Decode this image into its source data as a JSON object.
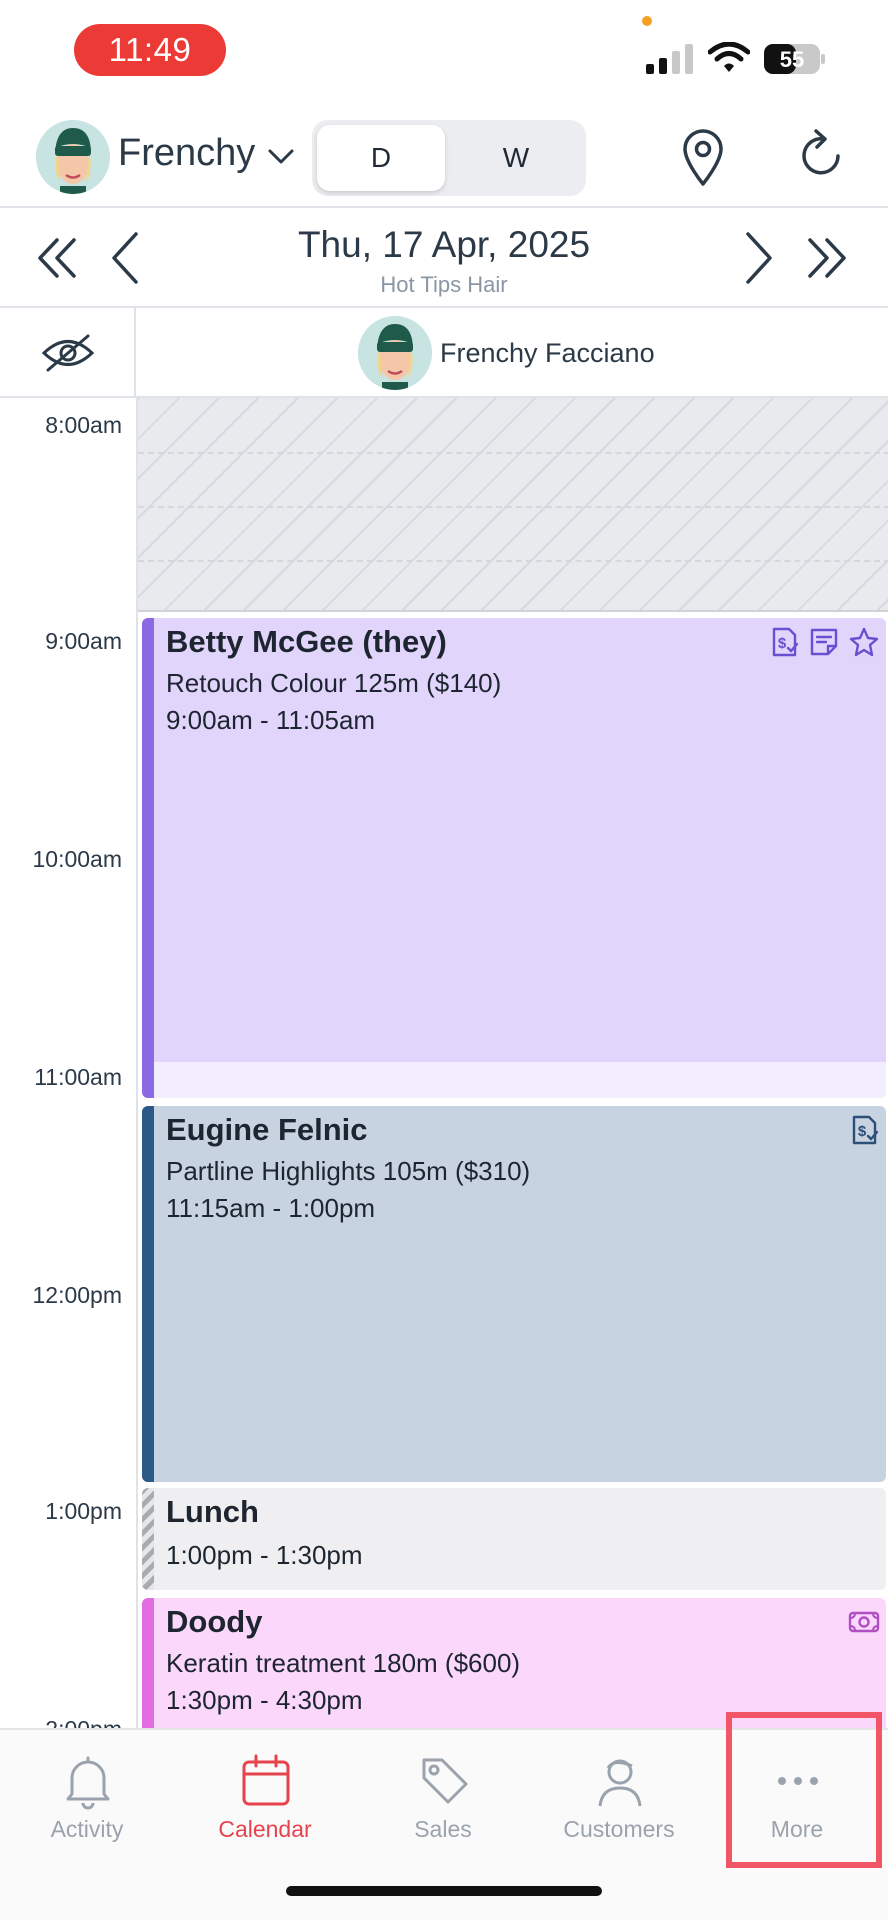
{
  "status_bar": {
    "time": "11:49",
    "battery": "55"
  },
  "header": {
    "staff_name": "Frenchy",
    "view_toggle": {
      "day": "D",
      "week": "W",
      "selected": "D"
    }
  },
  "date_nav": {
    "date": "Thu, 17 Apr, 2025",
    "location": "Hot Tips Hair"
  },
  "staff_column": {
    "name": "Frenchy Facciano"
  },
  "time_labels": [
    "8:00am",
    "9:00am",
    "10:00am",
    "11:00am",
    "12:00pm",
    "1:00pm",
    "2:00pm"
  ],
  "appointments": [
    {
      "client": "Betty McGee (they)",
      "service": "Retouch Colour 125m ($140)",
      "time": "9:00am - 11:05am",
      "color": "#e2d5fb",
      "accent": "#8b6ae3",
      "icons": [
        "invoice-icon",
        "note-icon",
        "star-icon"
      ]
    },
    {
      "client": "Eugine Felnic",
      "service": "Partline Highlights 105m ($310)",
      "time": "11:15am - 1:00pm",
      "color": "#c8d3e1",
      "accent": "#2c5a86",
      "icons": [
        "invoice-icon"
      ]
    },
    {
      "client": "Lunch",
      "service": "",
      "time": "1:00pm - 1:30pm",
      "color": "#efeff1",
      "accent": "#a8acb1",
      "icons": []
    },
    {
      "client": "Doody",
      "service": "Keratin treatment 180m ($600)",
      "time": "1:30pm - 4:30pm",
      "color": "#fbd8fb",
      "accent": "#e26de2",
      "icons": [
        "cash-icon"
      ]
    }
  ],
  "tabbar": {
    "tabs": [
      {
        "label": "Activity",
        "icon": "bell-icon",
        "active": false
      },
      {
        "label": "Calendar",
        "icon": "calendar-icon",
        "active": true
      },
      {
        "label": "Sales",
        "icon": "tag-icon",
        "active": false
      },
      {
        "label": "Customers",
        "icon": "person-icon",
        "active": false
      },
      {
        "label": "More",
        "icon": "ellipsis-icon",
        "active": false
      }
    ],
    "active_color": "#e6434d",
    "highlight_color": "#f25566"
  }
}
